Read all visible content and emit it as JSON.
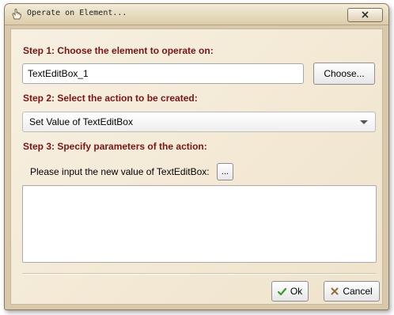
{
  "window": {
    "title": "Operate on Element...",
    "close_icon": "close-icon"
  },
  "step1": {
    "label": "Step 1: Choose the element to operate on:",
    "element_value": "TextEditBox_1",
    "choose_button": "Choose..."
  },
  "step2": {
    "label": "Step 2: Select the action to be created:",
    "selected_action": "Set Value of TextEditBox"
  },
  "step3": {
    "label": "Step 3: Specify parameters of the action:",
    "prompt": "Please input the new value of TextEditBox:",
    "ellipsis_button": "...",
    "value": ""
  },
  "footer": {
    "ok_label": "Ok",
    "cancel_label": "Cancel"
  },
  "colors": {
    "step_label": "#7a1414",
    "window_bg": "#f5ecdc",
    "ok_icon": "#3a9a2a",
    "cancel_icon": "#9a6a3a"
  }
}
